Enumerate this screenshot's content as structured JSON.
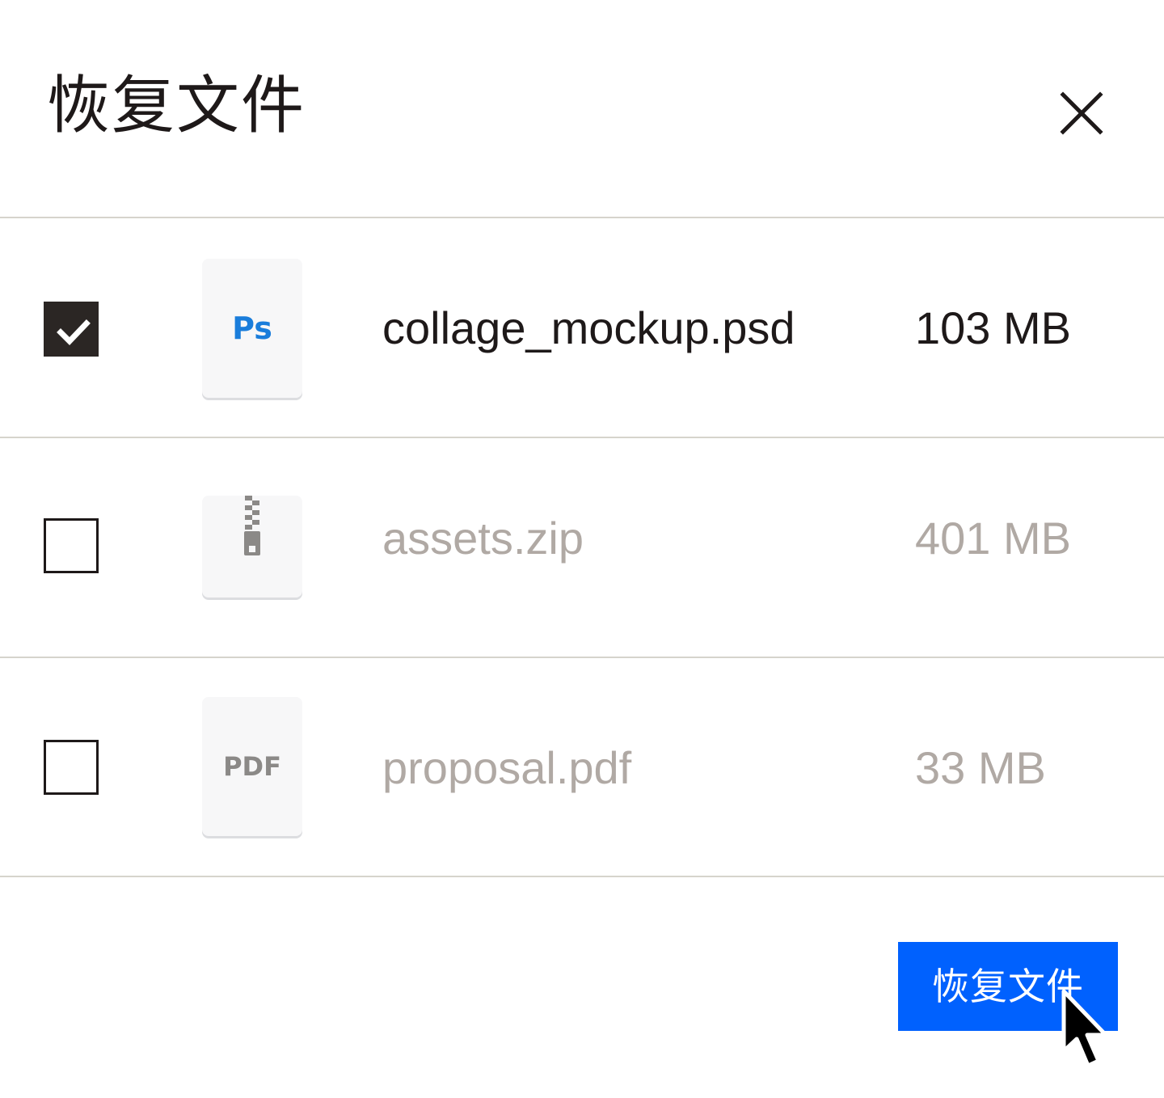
{
  "dialog": {
    "title": "恢复文件",
    "close_icon": "close-icon"
  },
  "files": [
    {
      "name": "collage_mockup.psd",
      "size": "103 MB",
      "checked": true,
      "icon": "photoshop-file-icon",
      "icon_label": "Ps"
    },
    {
      "name": "assets.zip",
      "size": "401 MB",
      "checked": false,
      "icon": "zip-file-icon",
      "icon_label": ""
    },
    {
      "name": "proposal.pdf",
      "size": "33 MB",
      "checked": false,
      "icon": "pdf-file-icon",
      "icon_label": "PDF"
    }
  ],
  "footer": {
    "restore_label": "恢复文件"
  },
  "colors": {
    "accent": "#0061fe",
    "checkbox_checked": "#2b2624",
    "text_primary": "#1e1919",
    "text_muted": "#b0a9a4",
    "ps_blue": "#1a7ddb",
    "divider": "#d6d4cc"
  }
}
